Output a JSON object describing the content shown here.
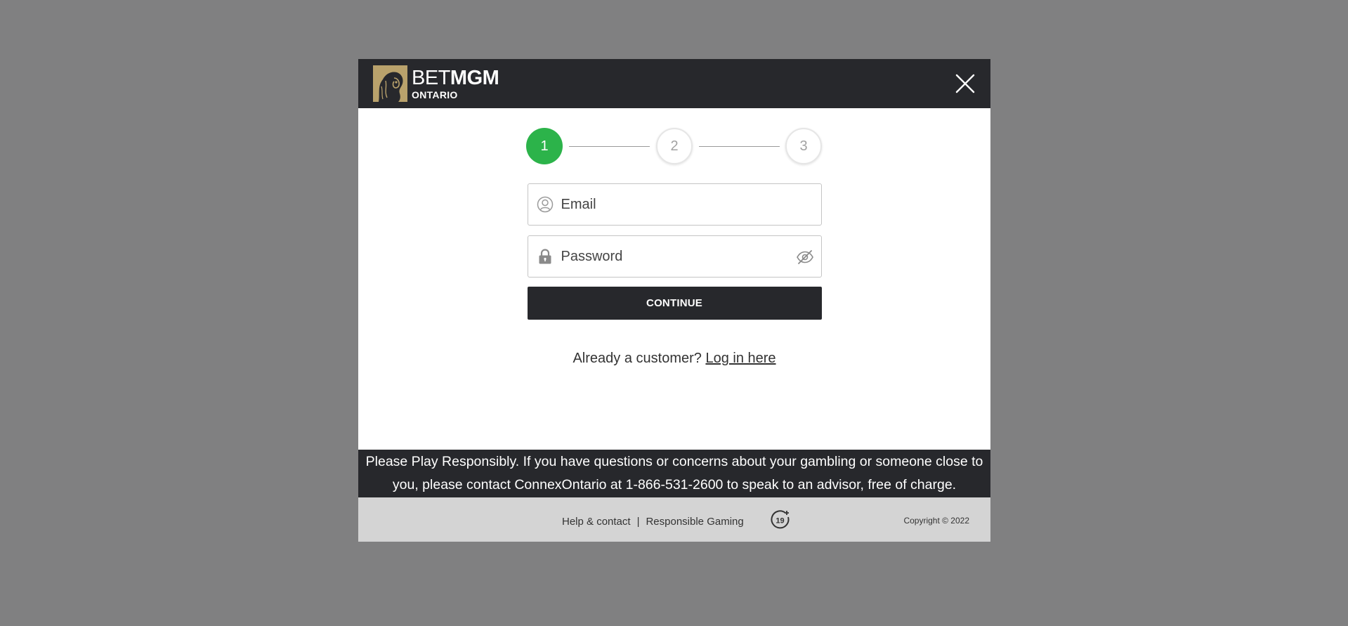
{
  "header": {
    "brand_main_thin": "BET",
    "brand_main_bold": "MGM",
    "brand_sub": "ONTARIO",
    "close_label": "Close"
  },
  "stepper": {
    "steps": [
      "1",
      "2",
      "3"
    ],
    "active_step": 1
  },
  "form": {
    "email_placeholder": "Email",
    "email_value": "",
    "password_placeholder": "Password",
    "password_value": "",
    "continue_label": "CONTINUE"
  },
  "login": {
    "prompt": "Already a customer? ",
    "link": "Log in here"
  },
  "notice": {
    "text": "Please Play Responsibly. If you have questions or concerns about your gambling or someone close to you, please contact ConnexOntario at 1-866-531-2600 to speak to an advisor, free of charge."
  },
  "footer": {
    "help_link": "Help & contact",
    "separator": "|",
    "responsible_link": "Responsible Gaming",
    "age_badge": "19",
    "copyright": "Copyright © 2022"
  },
  "colors": {
    "backdrop": "#808081",
    "header_bg": "#27282c",
    "brand_gold": "#b9a26c",
    "step_active": "#2cb34a",
    "footer_bg": "#d4d4d4"
  },
  "icons": {
    "email": "user-circle-icon",
    "password": "lock-icon",
    "visibility": "eye-off-icon",
    "close": "close-icon",
    "logo": "lion-logo-icon"
  }
}
